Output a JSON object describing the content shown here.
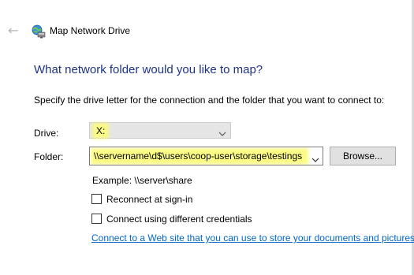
{
  "window": {
    "title": "Map Network Drive",
    "back_icon": "back-arrow-icon",
    "app_icon": "network-drive-icon"
  },
  "main": {
    "heading": "What network folder would you like to map?",
    "instruction": "Specify the drive letter for the connection and the folder that you want to connect to:",
    "drive": {
      "label": "Drive:",
      "value": "X:"
    },
    "folder": {
      "label": "Folder:",
      "value": "\\\\servername\\d$\\users\\coop-user\\storage\\testings"
    },
    "browse_label": "Browse...",
    "example": "Example: \\\\server\\share",
    "reconnect": {
      "label": "Reconnect at sign-in",
      "checked": false
    },
    "different_credentials": {
      "label": "Connect using different credentials",
      "checked": false
    },
    "link": "Connect to a Web site that you can use to store your documents and pictures."
  },
  "colors": {
    "heading": "#1e3287",
    "link": "#0066cc",
    "highlight": "#fbfb86"
  }
}
